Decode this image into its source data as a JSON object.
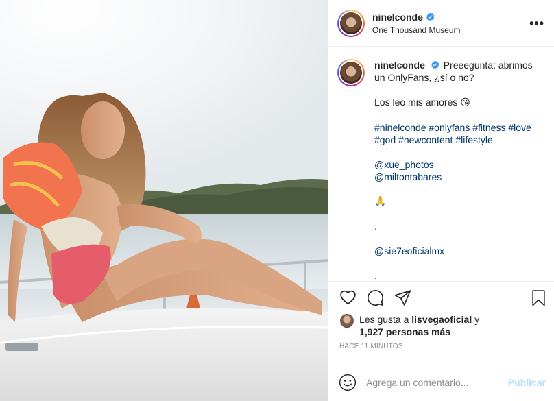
{
  "post": {
    "username": "ninelconde",
    "location": "One Thousand Museum",
    "more_icon": "more-horizontal-icon",
    "verified_color": "#3897f0"
  },
  "caption": {
    "username": "ninelconde",
    "line1": "Preeegunta: abrimos un OnlyFans, ¿sí o no?",
    "line2": "Los leo mis amores",
    "line2_emoji": "😘",
    "hashtags": "#ninelconde #onlyfans #fitness #love #god #newcontent #lifestyle",
    "mention1": "@xue_photos",
    "mention2": "@miltontabares",
    "pray_emoji": "🙏",
    "dot1": ".",
    "mention3": "@sie7eoficialmx",
    "dot2": "."
  },
  "actions": {
    "like_icon": "heart-icon",
    "comment_icon": "comment-icon",
    "share_icon": "share-icon",
    "save_icon": "bookmark-icon"
  },
  "likes": {
    "prefix": "Les gusta a",
    "liker": "lisvegaoficial",
    "joiner": "y",
    "count": "1,927 personas más"
  },
  "timestamp": "HACE 11 MINUTOS",
  "comment_box": {
    "placeholder": "Agrega un comentario...",
    "publish_label": "Publicar",
    "emoji_icon": "smile-icon"
  },
  "colors": {
    "link": "#00376b",
    "publish_disabled": "#b2dffc",
    "muted": "#8e8e8e"
  }
}
